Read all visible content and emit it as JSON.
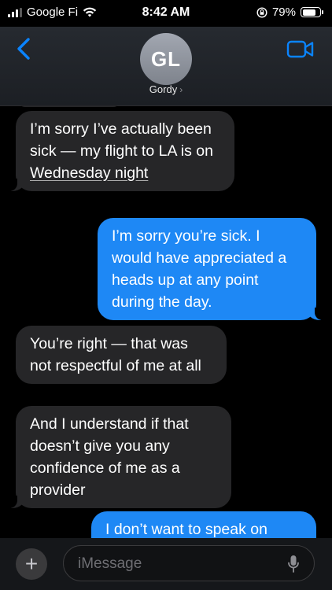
{
  "status_bar": {
    "carrier": "Google Fi",
    "time": "8:42 AM",
    "battery": "79%",
    "battery_level": 0.79
  },
  "header": {
    "avatar_initials": "GL",
    "contact_name": "Gordy",
    "back_icon": "chevron-left-icon",
    "video_icon": "video-camera-icon"
  },
  "messages": [
    {
      "from": "received",
      "text_before": "I’m sorry I’ve actually been sick — my flight to LA is on ",
      "link": "Wednesday night"
    },
    {
      "from": "sent",
      "text": "I’m sorry you’re sick. I would have appreciated a heads up at any point during the day."
    },
    {
      "from": "received",
      "text": "You’re right — that was not respectful of me at all"
    },
    {
      "from": "received",
      "text": "And I understand if that doesn’t give you any confidence of me as a provider"
    },
    {
      "from": "sent",
      "text": "I don’t want to speak on"
    }
  ],
  "input": {
    "placeholder": "iMessage",
    "plus_label": "+"
  },
  "colors": {
    "sent_bubble": "#1e88f5",
    "received_bubble": "#262628",
    "accent": "#0a84ff"
  }
}
